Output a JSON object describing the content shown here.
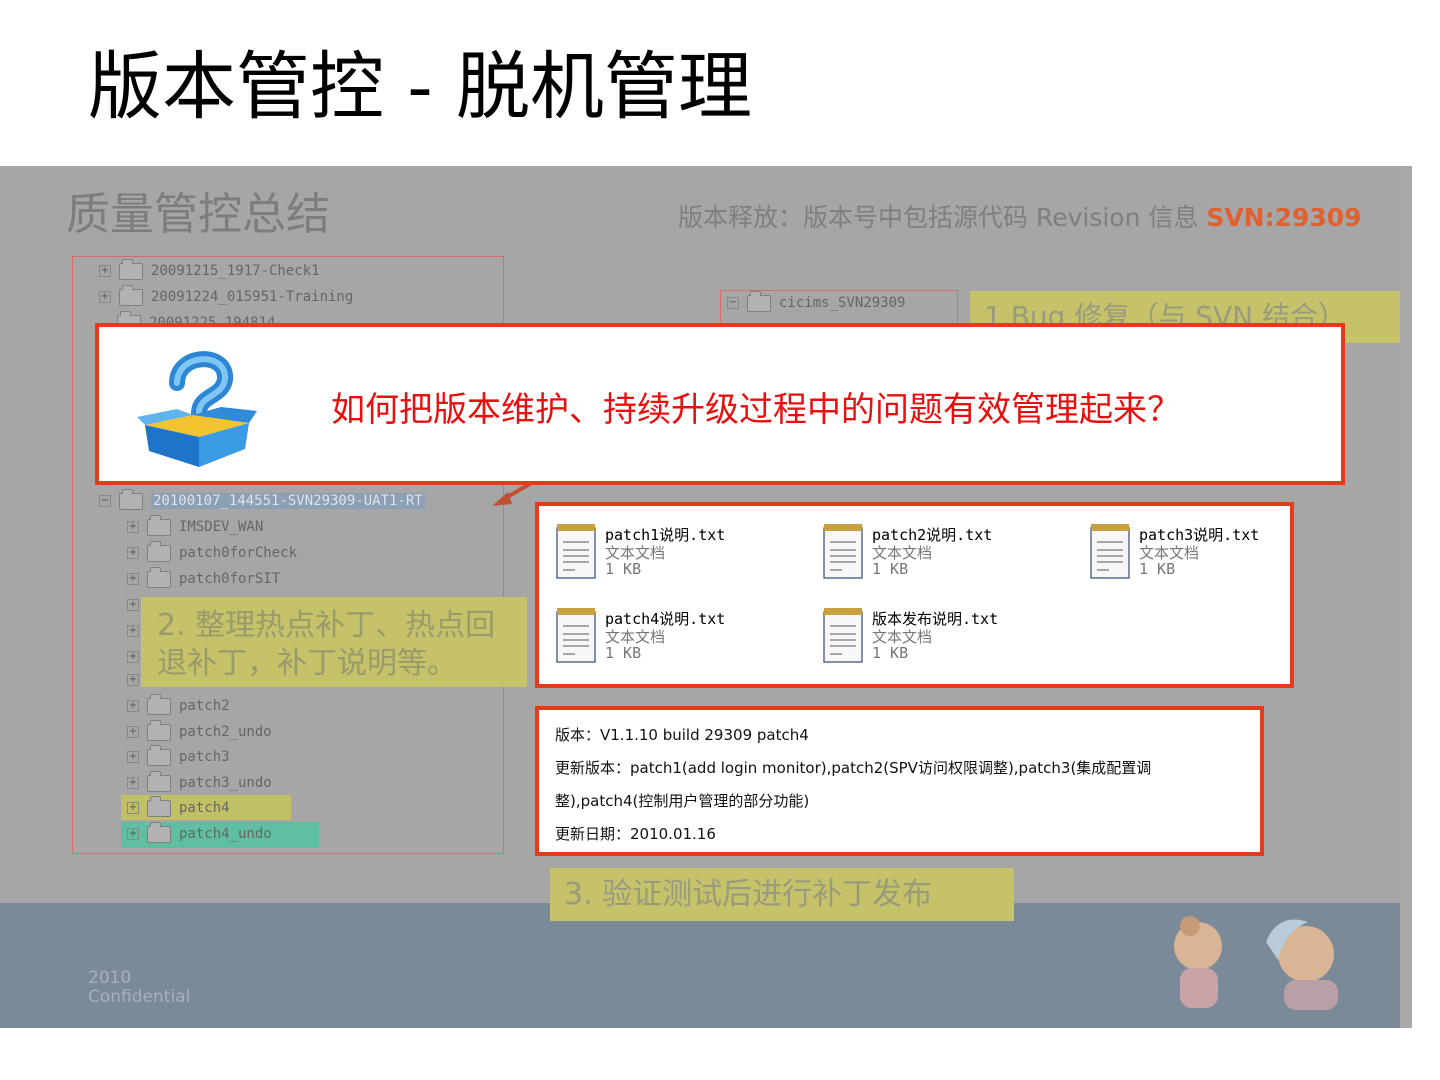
{
  "slide_title": "版本管控 - 脱机管理",
  "panel": {
    "heading": "质量管控总结",
    "release_note_prefix": "版本释放：版本号中包括源代码 Revision 信息 ",
    "release_note_svn": "SVN:29309"
  },
  "tree": {
    "top_items": [
      "20091215_1917-Check1",
      "20091224_015951-Training",
      "20091225_194814"
    ],
    "selected_item": "20100107_144551-SVN29309-UAT1-RT",
    "children": [
      "IMSDEV_WAN",
      "patch0forCheck",
      "patch0forSIT",
      "patch2",
      "patch2_undo",
      "patch3",
      "patch3_undo",
      "patch4",
      "patch4_undo"
    ]
  },
  "cicims": {
    "label": "cicims_SVN29309"
  },
  "labels": {
    "bug_fix": "1.Bug 修复（与 SVN 结合）",
    "hotfix": "2. 整理热点补丁、热点回退补丁，补丁说明等。",
    "verify": "3. 验证测试后进行补丁发布"
  },
  "question": {
    "text": "如何把版本维护、持续升级过程中的问题有效管理起来？"
  },
  "files": [
    {
      "name": "patch1说明.txt",
      "type": "文本文档",
      "size": "1 KB"
    },
    {
      "name": "patch2说明.txt",
      "type": "文本文档",
      "size": "1 KB"
    },
    {
      "name": "patch3说明.txt",
      "type": "文本文档",
      "size": "1 KB"
    },
    {
      "name": "patch4说明.txt",
      "type": "文本文档",
      "size": "1 KB"
    },
    {
      "name": "版本发布说明.txt",
      "type": "文本文档",
      "size": "1 KB"
    }
  ],
  "release_info": {
    "line1": "版本：V1.1.10 build 29309 patch4",
    "line2": "更新版本：patch1(add login monitor),patch2(SPV访问权限调整),patch3(集成配置调",
    "line3": "整),patch4(控制用户管理的部分功能)",
    "line4": "更新日期：2010.01.16"
  },
  "footer": {
    "year": "2010",
    "confidential": "Confidential"
  }
}
